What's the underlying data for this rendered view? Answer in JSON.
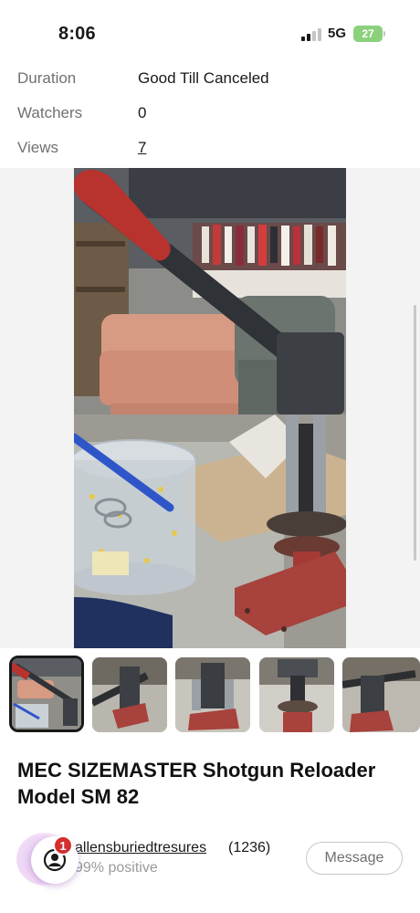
{
  "status_bar": {
    "time": "8:06",
    "network": "5G",
    "battery": "27"
  },
  "details": [
    {
      "label": "Duration",
      "value": "Good Till Canceled"
    },
    {
      "label": "Watchers",
      "value": "0"
    },
    {
      "label": "Views",
      "value": "7"
    }
  ],
  "listing": {
    "title": "MEC SIZEMASTER Shotgun Reloader Model SM 82"
  },
  "seller": {
    "name": "allensburiedtresures",
    "feedback_count": "(1236)",
    "positive": "99% positive",
    "message_label": "Message"
  },
  "float_button": {
    "badge": "1"
  },
  "colors": {
    "badge_red": "#d32f2f",
    "battery_green": "#8bd17c",
    "reloader_red": "#b8322e"
  }
}
